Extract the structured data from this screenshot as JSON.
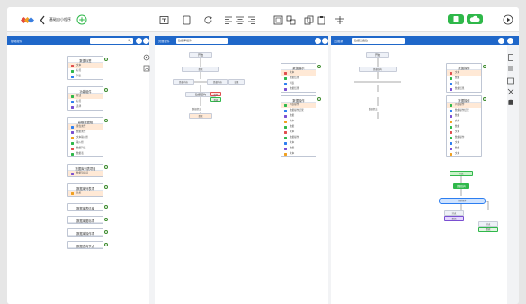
{
  "app": {
    "title": "基础自小程序"
  },
  "colors": {
    "accent": "#1f67c9",
    "green": "#2fb84a",
    "red": "#e04e4e",
    "blue": "#2d7ef0",
    "purple": "#7a4fd1",
    "orange": "#f0a020"
  },
  "panels": {
    "left": {
      "label": "基础组件",
      "search": ""
    },
    "middle": {
      "label": "页面组件",
      "select": "数据库组件"
    },
    "right": {
      "label": "云函数",
      "select": "数据云函数"
    }
  },
  "left_components": [
    {
      "title": "数据标签",
      "rows": [
        "文本",
        "标签",
        "列表"
      ]
    },
    {
      "title": "功能组件",
      "rows": [
        "按钮",
        "标签",
        "选择"
      ]
    },
    {
      "title": "高级键盘组",
      "rows": [
        "键盘类型",
        "数据类型",
        "文本输入框",
        "输入框",
        "数据列表",
        "数据表"
      ]
    },
    {
      "title": "数据库列表项目",
      "rows": [
        "数据列表项"
      ]
    },
    {
      "title": "数据库列表项",
      "rows": [
        "数据"
      ]
    },
    {
      "title": "数据库表情库"
    },
    {
      "title": "数据库图标项"
    },
    {
      "title": "数据库操作项"
    },
    {
      "title": "数据查询节点"
    }
  ],
  "middle_flow": {
    "start": "开始",
    "n1": "数据",
    "n2": "整体数据",
    "branch_a": "数据内容",
    "branch_b": "数据内容",
    "next": "结果",
    "cond": "数据结构",
    "out1": "数据",
    "out2": "数据",
    "end_label": "数据提交",
    "end_row": "数据"
  },
  "middle_side_components": [
    {
      "title": "数据展示",
      "rows": [
        "文本",
        "数据结果",
        "列表",
        "数据结果"
      ]
    },
    {
      "title": "数据操作",
      "rows": [
        "列表操作",
        "数据操作结果",
        "数据",
        "文本",
        "数据",
        "文本",
        "数据操作",
        "文本",
        "数据",
        "文本"
      ]
    }
  ],
  "right_flow": {
    "start": "开始",
    "end_label": "数据提交",
    "node_a": "数据结构",
    "decision": "判断条件",
    "b1": "分支",
    "b2": "分支",
    "out_a": "结果",
    "out_b": "结果",
    "out_a_row": "数据",
    "out_b_row": "数据"
  },
  "right_side_components": [
    {
      "title": "数据操作",
      "rows": [
        "文本",
        "数据",
        "列表",
        "数据结果"
      ]
    },
    {
      "title": "数据操作",
      "rows": [
        "列表操作",
        "数据操作结果",
        "数据",
        "文本",
        "数据",
        "文本",
        "数据操作",
        "文本",
        "数据",
        "文本"
      ]
    }
  ]
}
